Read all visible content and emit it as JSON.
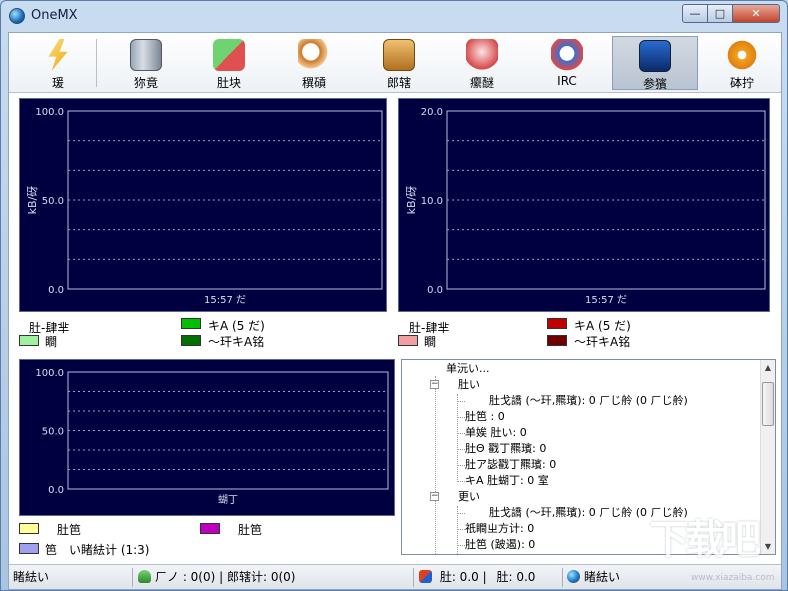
{
  "window": {
    "title": "OneMX"
  },
  "toolbar": {
    "items": [
      {
        "label": "瑗",
        "icon": "lightning-icon",
        "active": false
      },
      {
        "label": "狝竟",
        "icon": "server-icon",
        "active": false
      },
      {
        "label": "肚块",
        "icon": "transfer-arrows-icon",
        "active": false
      },
      {
        "label": "穓碽",
        "icon": "search-icon",
        "active": false
      },
      {
        "label": "郎辖",
        "icon": "shared-box-icon",
        "active": false
      },
      {
        "label": "癳醚",
        "icon": "messages-icon",
        "active": false
      },
      {
        "label": "IRC",
        "icon": "irc-icon",
        "active": false
      },
      {
        "label": "参獱",
        "icon": "statistics-icon",
        "active": true
      },
      {
        "label": "砵拧",
        "icon": "gear-icon",
        "active": false
      }
    ]
  },
  "chart_data": [
    {
      "type": "line",
      "ylabel": "kB/砑",
      "xlabel": "15:57 だ",
      "ylim": [
        0,
        100
      ],
      "yticks": [
        "100.0",
        "50.0",
        "0.0"
      ],
      "grid": true,
      "series": [
        {
          "name": "キΑ (5 だ)",
          "color": "#00c000",
          "values": []
        },
        {
          "name": "～玕キΑ铭",
          "color": "#007000",
          "values": []
        }
      ],
      "legend": {
        "title": "肚-肆芈",
        "current_label": "瞷",
        "current_color": "#a0f0a0"
      }
    },
    {
      "type": "line",
      "ylabel": "kB/砑",
      "xlabel": "15:57 だ",
      "ylim": [
        0,
        20
      ],
      "yticks": [
        "20.0",
        "10.0",
        "0.0"
      ],
      "grid": true,
      "series": [
        {
          "name": "キΑ (5 だ)",
          "color": "#c00000",
          "values": []
        },
        {
          "name": "～玕キΑ铭",
          "color": "#700000",
          "values": []
        }
      ],
      "legend": {
        "title": "肚-肆芈",
        "current_label": "瞷",
        "current_color": "#f0a0a0"
      }
    },
    {
      "type": "line",
      "ylabel": "",
      "xlabel": "蝴丁",
      "ylim": [
        0,
        100
      ],
      "yticks": [
        "100.0",
        "50.0",
        "0.0"
      ],
      "grid": true,
      "series": [
        {
          "name": "肚笆",
          "color": "#ffff99",
          "values": []
        },
        {
          "name": "肚笆",
          "color": "#c000c0",
          "values": []
        },
        {
          "name": "い睹紶计 (1:3)",
          "color": "#a0a0f0",
          "values": []
        }
      ],
      "legend": {
        "extra_label": "笆"
      }
    }
  ],
  "tree": {
    "rows": [
      {
        "text": "单沅い...",
        "level": 0,
        "expander": ""
      },
      {
        "text": "肚い",
        "level": 1,
        "expander": "−"
      },
      {
        "text": "肚戈譑 (～玕,羆璸): 0 ㄏじ舲 (0 ㄏじ舲)",
        "level": 3,
        "expander": ""
      },
      {
        "text": "肚笆   : 0",
        "level": 2,
        "expander": ""
      },
      {
        "text": "单娭  肚い: 0",
        "level": 2,
        "expander": ""
      },
      {
        "text": "肚Θ   戳丁羆璸: 0",
        "level": 2,
        "expander": ""
      },
      {
        "text": "肚ア毖戳丁羆璸: 0",
        "level": 2,
        "expander": ""
      },
      {
        "text": "キΑ   肚蝴丁: 0 室",
        "level": 2,
        "expander": ""
      },
      {
        "text": "更い",
        "level": 1,
        "expander": "−"
      },
      {
        "text": "肚戈譑 (～玕,羆璸): 0 ㄏじ舲 (0 ㄏじ舲)",
        "level": 3,
        "expander": ""
      },
      {
        "text": "祇瞷ㄓ方计: 0",
        "level": 2,
        "expander": ""
      },
      {
        "text": "肚笆    (跛遏): 0",
        "level": 2,
        "expander": ""
      }
    ]
  },
  "status": {
    "left": "睹紶い",
    "users": "ㄏノ   : 0(0) | 郎辖计: 0(0)",
    "down": "肚: 0.0 |",
    "up": "肚: 0.0",
    "conn": "睹紶い"
  },
  "watermark": {
    "text": "下载吧",
    "url": "www.xiazaiba.com"
  }
}
